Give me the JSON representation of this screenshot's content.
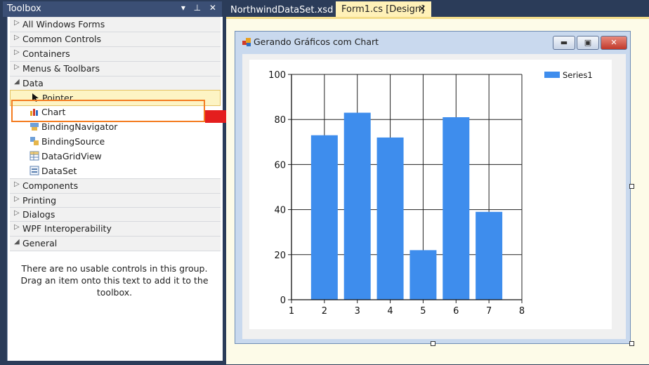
{
  "toolbox": {
    "title": "Toolbox",
    "header_buttons": "▾ ⊥ ✕",
    "categories_top": [
      {
        "label": "All Windows Forms"
      },
      {
        "label": "Common Controls"
      },
      {
        "label": "Containers"
      },
      {
        "label": "Menus & Toolbars"
      }
    ],
    "data_category": "Data",
    "data_items": [
      {
        "label": "Pointer",
        "icon": "pointer-icon"
      },
      {
        "label": "Chart",
        "icon": "chart-icon"
      },
      {
        "label": "BindingNavigator",
        "icon": "binding-navigator-icon"
      },
      {
        "label": "BindingSource",
        "icon": "binding-source-icon"
      },
      {
        "label": "DataGridView",
        "icon": "datagridview-icon"
      },
      {
        "label": "DataSet",
        "icon": "dataset-icon"
      }
    ],
    "categories_bottom": [
      {
        "label": "Components"
      },
      {
        "label": "Printing"
      },
      {
        "label": "Dialogs"
      },
      {
        "label": "WPF Interoperability"
      }
    ],
    "general_category": "General",
    "general_message": "There are no usable controls in this group. Drag an item onto this text to add it to the toolbox."
  },
  "tabs": [
    {
      "label": "NorthwindDataSet.xsd",
      "active": false
    },
    {
      "label": "Form1.cs [Design]",
      "active": true,
      "close": "✕"
    }
  ],
  "form": {
    "title": "Gerando Gráficos com Chart",
    "buttons": {
      "minimize": "▬",
      "maximize": "▣",
      "close": "✕"
    }
  },
  "colors": {
    "accent": "#f47c20",
    "arrow": "#e41e1e",
    "bar": "#3e8ded"
  },
  "chart_data": {
    "type": "bar",
    "x": [
      2,
      3,
      4,
      5,
      6,
      7
    ],
    "series": [
      {
        "name": "Series1",
        "values": [
          73,
          83,
          72,
          22,
          81,
          39
        ]
      }
    ],
    "xlim": [
      1,
      8
    ],
    "ylim": [
      0,
      100
    ],
    "xticks": [
      1,
      2,
      3,
      4,
      5,
      6,
      7,
      8
    ],
    "yticks": [
      0,
      20,
      40,
      60,
      80,
      100
    ],
    "grid": true,
    "legend": "top-right"
  }
}
